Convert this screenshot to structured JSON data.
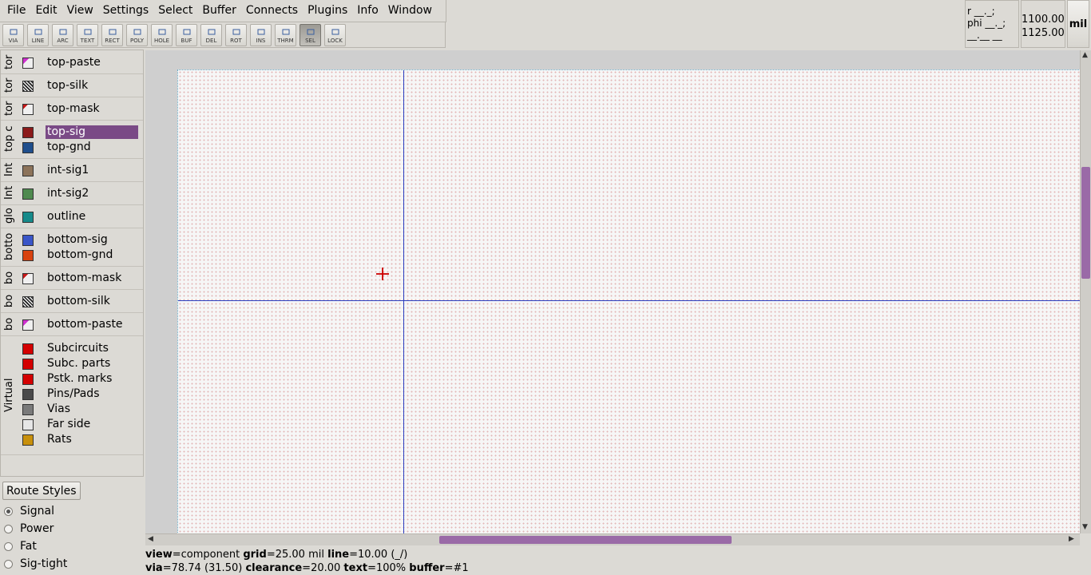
{
  "menu": [
    "File",
    "Edit",
    "View",
    "Settings",
    "Select",
    "Buffer",
    "Connects",
    "Plugins",
    "Info",
    "Window"
  ],
  "tools": [
    {
      "label": "VIA",
      "icon": "via-icon",
      "active": false
    },
    {
      "label": "LINE",
      "icon": "line-icon",
      "active": false
    },
    {
      "label": "ARC",
      "icon": "arc-icon",
      "active": false
    },
    {
      "label": "TEXT",
      "icon": "text-icon",
      "active": false
    },
    {
      "label": "RECT",
      "icon": "rect-icon",
      "active": false
    },
    {
      "label": "POLY",
      "icon": "poly-icon",
      "active": false
    },
    {
      "label": "HOLE",
      "icon": "hole-icon",
      "active": false
    },
    {
      "label": "BUF",
      "icon": "buffer-icon",
      "active": false
    },
    {
      "label": "DEL",
      "icon": "delete-icon",
      "active": false
    },
    {
      "label": "ROT",
      "icon": "rotate-icon",
      "active": false
    },
    {
      "label": "INS",
      "icon": "insert-icon",
      "active": false
    },
    {
      "label": "THRM",
      "icon": "thermal-icon",
      "active": false
    },
    {
      "label": "SEL",
      "icon": "select-arrow-icon",
      "active": true
    },
    {
      "label": "LOCK",
      "icon": "lock-icon",
      "active": false
    }
  ],
  "coords": {
    "line1": "r __._;",
    "line2": "phi __._;",
    "line3": "__.__ __"
  },
  "abs": {
    "x": "1100.00",
    "y": "1125.00"
  },
  "unit": "mil",
  "layer_groups": [
    {
      "label": "tor",
      "layers": [
        {
          "name": "top-paste",
          "color": "#f0f0f0",
          "pattern": "paste"
        }
      ]
    },
    {
      "label": "tor",
      "layers": [
        {
          "name": "top-silk",
          "color": "#202020",
          "pattern": "hatch"
        }
      ]
    },
    {
      "label": "tor",
      "layers": [
        {
          "name": "top-mask",
          "color": "#f0f0f0",
          "pattern": "mask"
        }
      ]
    },
    {
      "label": "top c",
      "layers": [
        {
          "name": "top-sig",
          "color": "#8b1a1a",
          "selected": true
        },
        {
          "name": "top-gnd",
          "color": "#1f4e8c"
        }
      ]
    },
    {
      "label": "Int",
      "layers": [
        {
          "name": "int-sig1",
          "color": "#8c735a"
        }
      ]
    },
    {
      "label": "Int",
      "layers": [
        {
          "name": "int-sig2",
          "color": "#4f8a4f"
        }
      ]
    },
    {
      "label": "glo",
      "layers": [
        {
          "name": "outline",
          "color": "#168a8a"
        }
      ]
    },
    {
      "label": "botto",
      "layers": [
        {
          "name": "bottom-sig",
          "color": "#3a56c8"
        },
        {
          "name": "bottom-gnd",
          "color": "#d8420e"
        }
      ]
    },
    {
      "label": "bo",
      "layers": [
        {
          "name": "bottom-mask",
          "color": "#f0f0f0",
          "pattern": "mask"
        }
      ]
    },
    {
      "label": "bo",
      "layers": [
        {
          "name": "bottom-silk",
          "color": "#202020",
          "pattern": "hatch"
        }
      ]
    },
    {
      "label": "bo",
      "layers": [
        {
          "name": "bottom-paste",
          "color": "#f0f0f0",
          "pattern": "paste"
        }
      ]
    },
    {
      "label": "Virtual",
      "layers": [
        {
          "name": "Subcircuits",
          "color": "#d40000"
        },
        {
          "name": "Subc. parts",
          "color": "#d40000"
        },
        {
          "name": "Pstk. marks",
          "color": "#d40000"
        },
        {
          "name": "Pins/Pads",
          "color": "#4a4a4a"
        },
        {
          "name": "Vias",
          "color": "#7a7a7a"
        },
        {
          "name": "Far side",
          "color": "#e6e6e6"
        },
        {
          "name": "Rats",
          "color": "#c8900c"
        }
      ]
    }
  ],
  "route_styles": {
    "button": "Route Styles",
    "options": [
      {
        "label": "Signal",
        "selected": true
      },
      {
        "label": "Power",
        "selected": false
      },
      {
        "label": "Fat",
        "selected": false
      },
      {
        "label": "Sig-tight",
        "selected": false
      }
    ]
  },
  "status": {
    "view_key": "view",
    "view_val": "=component",
    "grid_key": "grid",
    "grid_val": "=25.00 mil",
    "line_key": "line",
    "line_val": "=10.00 (_/)",
    "via_key": "via",
    "via_val": "=78.74 (31.50)",
    "clearance_key": "clearance",
    "clearance_val": "=20.00",
    "text_key": "text",
    "text_val": "=100%",
    "buffer_key": "buffer",
    "buffer_val": "=#1"
  },
  "scroll": {
    "vertical_fraction": 0.24,
    "horizontal_fraction": 0.32
  }
}
